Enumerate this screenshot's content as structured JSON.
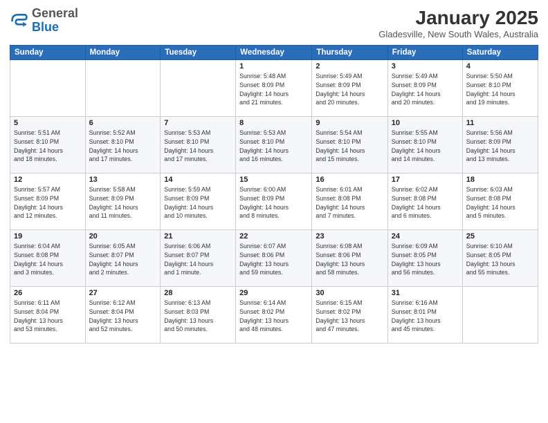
{
  "logo": {
    "line1": "General",
    "line2": "Blue"
  },
  "title": "January 2025",
  "location": "Gladesville, New South Wales, Australia",
  "weekdays": [
    "Sunday",
    "Monday",
    "Tuesday",
    "Wednesday",
    "Thursday",
    "Friday",
    "Saturday"
  ],
  "weeks": [
    [
      {
        "day": "",
        "info": ""
      },
      {
        "day": "",
        "info": ""
      },
      {
        "day": "",
        "info": ""
      },
      {
        "day": "1",
        "info": "Sunrise: 5:48 AM\nSunset: 8:09 PM\nDaylight: 14 hours\nand 21 minutes."
      },
      {
        "day": "2",
        "info": "Sunrise: 5:49 AM\nSunset: 8:09 PM\nDaylight: 14 hours\nand 20 minutes."
      },
      {
        "day": "3",
        "info": "Sunrise: 5:49 AM\nSunset: 8:09 PM\nDaylight: 14 hours\nand 20 minutes."
      },
      {
        "day": "4",
        "info": "Sunrise: 5:50 AM\nSunset: 8:10 PM\nDaylight: 14 hours\nand 19 minutes."
      }
    ],
    [
      {
        "day": "5",
        "info": "Sunrise: 5:51 AM\nSunset: 8:10 PM\nDaylight: 14 hours\nand 18 minutes."
      },
      {
        "day": "6",
        "info": "Sunrise: 5:52 AM\nSunset: 8:10 PM\nDaylight: 14 hours\nand 17 minutes."
      },
      {
        "day": "7",
        "info": "Sunrise: 5:53 AM\nSunset: 8:10 PM\nDaylight: 14 hours\nand 17 minutes."
      },
      {
        "day": "8",
        "info": "Sunrise: 5:53 AM\nSunset: 8:10 PM\nDaylight: 14 hours\nand 16 minutes."
      },
      {
        "day": "9",
        "info": "Sunrise: 5:54 AM\nSunset: 8:10 PM\nDaylight: 14 hours\nand 15 minutes."
      },
      {
        "day": "10",
        "info": "Sunrise: 5:55 AM\nSunset: 8:10 PM\nDaylight: 14 hours\nand 14 minutes."
      },
      {
        "day": "11",
        "info": "Sunrise: 5:56 AM\nSunset: 8:09 PM\nDaylight: 14 hours\nand 13 minutes."
      }
    ],
    [
      {
        "day": "12",
        "info": "Sunrise: 5:57 AM\nSunset: 8:09 PM\nDaylight: 14 hours\nand 12 minutes."
      },
      {
        "day": "13",
        "info": "Sunrise: 5:58 AM\nSunset: 8:09 PM\nDaylight: 14 hours\nand 11 minutes."
      },
      {
        "day": "14",
        "info": "Sunrise: 5:59 AM\nSunset: 8:09 PM\nDaylight: 14 hours\nand 10 minutes."
      },
      {
        "day": "15",
        "info": "Sunrise: 6:00 AM\nSunset: 8:09 PM\nDaylight: 14 hours\nand 8 minutes."
      },
      {
        "day": "16",
        "info": "Sunrise: 6:01 AM\nSunset: 8:08 PM\nDaylight: 14 hours\nand 7 minutes."
      },
      {
        "day": "17",
        "info": "Sunrise: 6:02 AM\nSunset: 8:08 PM\nDaylight: 14 hours\nand 6 minutes."
      },
      {
        "day": "18",
        "info": "Sunrise: 6:03 AM\nSunset: 8:08 PM\nDaylight: 14 hours\nand 5 minutes."
      }
    ],
    [
      {
        "day": "19",
        "info": "Sunrise: 6:04 AM\nSunset: 8:08 PM\nDaylight: 14 hours\nand 3 minutes."
      },
      {
        "day": "20",
        "info": "Sunrise: 6:05 AM\nSunset: 8:07 PM\nDaylight: 14 hours\nand 2 minutes."
      },
      {
        "day": "21",
        "info": "Sunrise: 6:06 AM\nSunset: 8:07 PM\nDaylight: 14 hours\nand 1 minute."
      },
      {
        "day": "22",
        "info": "Sunrise: 6:07 AM\nSunset: 8:06 PM\nDaylight: 13 hours\nand 59 minutes."
      },
      {
        "day": "23",
        "info": "Sunrise: 6:08 AM\nSunset: 8:06 PM\nDaylight: 13 hours\nand 58 minutes."
      },
      {
        "day": "24",
        "info": "Sunrise: 6:09 AM\nSunset: 8:05 PM\nDaylight: 13 hours\nand 56 minutes."
      },
      {
        "day": "25",
        "info": "Sunrise: 6:10 AM\nSunset: 8:05 PM\nDaylight: 13 hours\nand 55 minutes."
      }
    ],
    [
      {
        "day": "26",
        "info": "Sunrise: 6:11 AM\nSunset: 8:04 PM\nDaylight: 13 hours\nand 53 minutes."
      },
      {
        "day": "27",
        "info": "Sunrise: 6:12 AM\nSunset: 8:04 PM\nDaylight: 13 hours\nand 52 minutes."
      },
      {
        "day": "28",
        "info": "Sunrise: 6:13 AM\nSunset: 8:03 PM\nDaylight: 13 hours\nand 50 minutes."
      },
      {
        "day": "29",
        "info": "Sunrise: 6:14 AM\nSunset: 8:02 PM\nDaylight: 13 hours\nand 48 minutes."
      },
      {
        "day": "30",
        "info": "Sunrise: 6:15 AM\nSunset: 8:02 PM\nDaylight: 13 hours\nand 47 minutes."
      },
      {
        "day": "31",
        "info": "Sunrise: 6:16 AM\nSunset: 8:01 PM\nDaylight: 13 hours\nand 45 minutes."
      },
      {
        "day": "",
        "info": ""
      }
    ]
  ]
}
